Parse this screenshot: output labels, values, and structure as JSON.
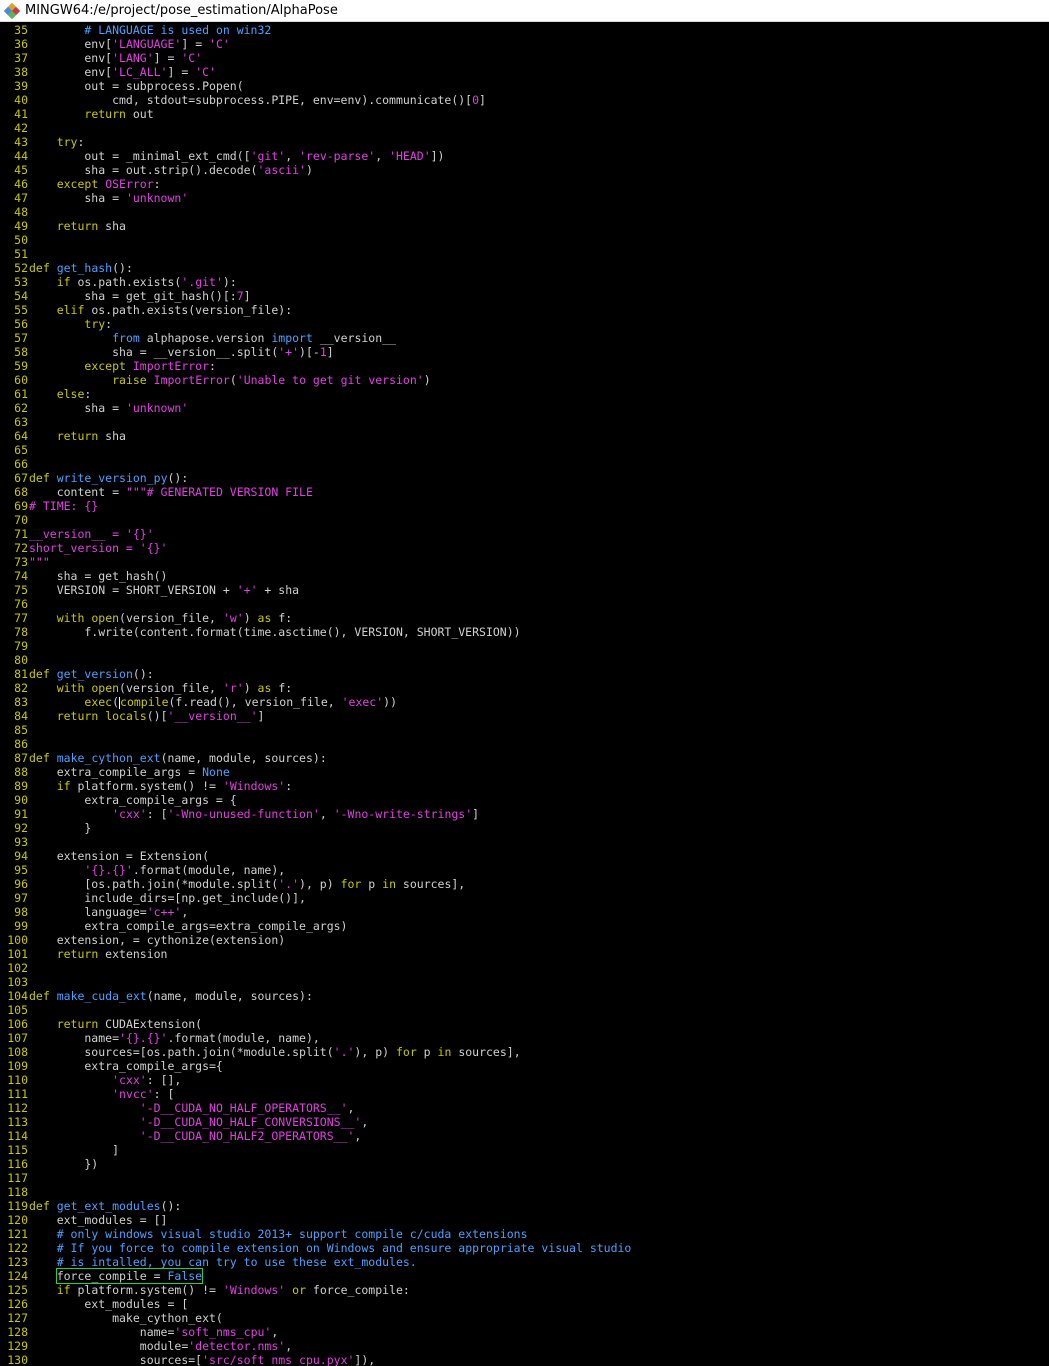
{
  "window": {
    "title": "MINGW64:/e/project/pose_estimation/AlphaPose"
  },
  "colors": {
    "line_number": "#c8c800",
    "keyword": "#c8c800",
    "string": "#e040e0",
    "comment": "#4aa0ff",
    "default": "#d0d0d0",
    "background": "#000000"
  },
  "lines": [
    {
      "n": "35",
      "t": [
        [
          "        ",
          ""
        ],
        [
          "# LANGUAGE is used on win32",
          "c"
        ]
      ]
    },
    {
      "n": "36",
      "t": [
        [
          "        env[",
          ""
        ],
        [
          "'LANGUAGE'",
          "s"
        ],
        [
          "] = ",
          ""
        ],
        [
          "'C'",
          "s"
        ]
      ]
    },
    {
      "n": "37",
      "t": [
        [
          "        env[",
          ""
        ],
        [
          "'LANG'",
          "s"
        ],
        [
          "] = ",
          ""
        ],
        [
          "'C'",
          "s"
        ]
      ]
    },
    {
      "n": "38",
      "t": [
        [
          "        env[",
          ""
        ],
        [
          "'LC_ALL'",
          "s"
        ],
        [
          "] = ",
          ""
        ],
        [
          "'C'",
          "s"
        ]
      ]
    },
    {
      "n": "39",
      "t": [
        [
          "        out = subprocess.Popen(",
          ""
        ]
      ]
    },
    {
      "n": "40",
      "t": [
        [
          "            cmd, stdout=subprocess.PIPE, env=env).communicate()[",
          ""
        ],
        [
          "0",
          "s"
        ],
        [
          "]",
          ""
        ]
      ]
    },
    {
      "n": "41",
      "t": [
        [
          "        ",
          ""
        ],
        [
          "return",
          "k"
        ],
        [
          " out",
          ""
        ]
      ]
    },
    {
      "n": "42",
      "t": []
    },
    {
      "n": "43",
      "t": [
        [
          "    ",
          ""
        ],
        [
          "try",
          "k"
        ],
        [
          ":",
          ""
        ]
      ]
    },
    {
      "n": "44",
      "t": [
        [
          "        out = _minimal_ext_cmd([",
          ""
        ],
        [
          "'git'",
          "s"
        ],
        [
          ", ",
          ""
        ],
        [
          "'rev-parse'",
          "s"
        ],
        [
          ", ",
          ""
        ],
        [
          "'HEAD'",
          "s"
        ],
        [
          "])",
          ""
        ]
      ]
    },
    {
      "n": "45",
      "t": [
        [
          "        sha = out.strip().decode(",
          ""
        ],
        [
          "'ascii'",
          "s"
        ],
        [
          ")",
          ""
        ]
      ]
    },
    {
      "n": "46",
      "t": [
        [
          "    ",
          ""
        ],
        [
          "except",
          "k"
        ],
        [
          " ",
          ""
        ],
        [
          "OSError",
          "s"
        ],
        [
          ":",
          ""
        ]
      ]
    },
    {
      "n": "47",
      "t": [
        [
          "        sha = ",
          ""
        ],
        [
          "'unknown'",
          "s"
        ]
      ]
    },
    {
      "n": "48",
      "t": []
    },
    {
      "n": "49",
      "t": [
        [
          "    ",
          ""
        ],
        [
          "return",
          "k"
        ],
        [
          " sha",
          ""
        ]
      ]
    },
    {
      "n": "50",
      "t": []
    },
    {
      "n": "51",
      "t": []
    },
    {
      "n": "52",
      "t": [
        [
          "def",
          "k"
        ],
        [
          " ",
          ""
        ],
        [
          "get_hash",
          "b"
        ],
        [
          "():",
          ""
        ]
      ]
    },
    {
      "n": "53",
      "t": [
        [
          "    ",
          ""
        ],
        [
          "if",
          "k"
        ],
        [
          " os.path.exists(",
          ""
        ],
        [
          "'.git'",
          "s"
        ],
        [
          "):",
          ""
        ]
      ]
    },
    {
      "n": "54",
      "t": [
        [
          "        sha = get_git_hash()[:",
          ""
        ],
        [
          "7",
          "s"
        ],
        [
          "]",
          ""
        ]
      ]
    },
    {
      "n": "55",
      "t": [
        [
          "    ",
          ""
        ],
        [
          "elif",
          "k"
        ],
        [
          " os.path.exists(version_file):",
          ""
        ]
      ]
    },
    {
      "n": "56",
      "t": [
        [
          "        ",
          ""
        ],
        [
          "try",
          "k"
        ],
        [
          ":",
          ""
        ]
      ]
    },
    {
      "n": "57",
      "t": [
        [
          "            ",
          ""
        ],
        [
          "from",
          "b"
        ],
        [
          " alphapose.version ",
          ""
        ],
        [
          "import",
          "b"
        ],
        [
          " __version__",
          ""
        ]
      ]
    },
    {
      "n": "58",
      "t": [
        [
          "            sha = __version__.split(",
          ""
        ],
        [
          "'+'",
          "s"
        ],
        [
          ")[-",
          ""
        ],
        [
          "1",
          "s"
        ],
        [
          "]",
          ""
        ]
      ]
    },
    {
      "n": "59",
      "t": [
        [
          "        ",
          ""
        ],
        [
          "except",
          "k"
        ],
        [
          " ",
          ""
        ],
        [
          "ImportError",
          "s"
        ],
        [
          ":",
          ""
        ]
      ]
    },
    {
      "n": "60",
      "t": [
        [
          "            ",
          ""
        ],
        [
          "raise",
          "k"
        ],
        [
          " ",
          ""
        ],
        [
          "ImportError",
          "s"
        ],
        [
          "(",
          ""
        ],
        [
          "'Unable to get git version'",
          "s"
        ],
        [
          ")",
          ""
        ]
      ]
    },
    {
      "n": "61",
      "t": [
        [
          "    ",
          ""
        ],
        [
          "else",
          "k"
        ],
        [
          ":",
          ""
        ]
      ]
    },
    {
      "n": "62",
      "t": [
        [
          "        sha = ",
          ""
        ],
        [
          "'unknown'",
          "s"
        ]
      ]
    },
    {
      "n": "63",
      "t": []
    },
    {
      "n": "64",
      "t": [
        [
          "    ",
          ""
        ],
        [
          "return",
          "k"
        ],
        [
          " sha",
          ""
        ]
      ]
    },
    {
      "n": "65",
      "t": []
    },
    {
      "n": "66",
      "t": []
    },
    {
      "n": "67",
      "t": [
        [
          "def",
          "k"
        ],
        [
          " ",
          ""
        ],
        [
          "write_version_py",
          "b"
        ],
        [
          "():",
          ""
        ]
      ]
    },
    {
      "n": "68",
      "t": [
        [
          "    content = ",
          ""
        ],
        [
          "\"\"\"# GENERATED VERSION FILE",
          "s"
        ]
      ]
    },
    {
      "n": "69",
      "t": [
        [
          "# TIME: {}",
          "s"
        ]
      ]
    },
    {
      "n": "70",
      "t": []
    },
    {
      "n": "71",
      "t": [
        [
          "__version__ = '{}'",
          "s"
        ]
      ]
    },
    {
      "n": "72",
      "t": [
        [
          "short_version = '{}'",
          "s"
        ]
      ]
    },
    {
      "n": "73",
      "t": [
        [
          "\"\"\"",
          "s"
        ]
      ]
    },
    {
      "n": "74",
      "t": [
        [
          "    sha = get_hash()",
          ""
        ]
      ]
    },
    {
      "n": "75",
      "t": [
        [
          "    VERSION = SHORT_VERSION + ",
          ""
        ],
        [
          "'+'",
          "s"
        ],
        [
          " + sha",
          ""
        ]
      ]
    },
    {
      "n": "76",
      "t": []
    },
    {
      "n": "77",
      "t": [
        [
          "    ",
          ""
        ],
        [
          "with",
          "k"
        ],
        [
          " ",
          ""
        ],
        [
          "open",
          "k"
        ],
        [
          "(version_file, ",
          ""
        ],
        [
          "'w'",
          "s"
        ],
        [
          ") ",
          ""
        ],
        [
          "as",
          "k"
        ],
        [
          " f:",
          ""
        ]
      ]
    },
    {
      "n": "78",
      "t": [
        [
          "        f.write(content.format(time.asctime(), VERSION, SHORT_VERSION))",
          ""
        ]
      ]
    },
    {
      "n": "79",
      "t": []
    },
    {
      "n": "80",
      "t": []
    },
    {
      "n": "81",
      "t": [
        [
          "def",
          "k"
        ],
        [
          " ",
          ""
        ],
        [
          "get_version",
          "b"
        ],
        [
          "():",
          ""
        ]
      ]
    },
    {
      "n": "82",
      "t": [
        [
          "    ",
          ""
        ],
        [
          "with",
          "k"
        ],
        [
          " ",
          ""
        ],
        [
          "open",
          "k"
        ],
        [
          "(version_file, ",
          ""
        ],
        [
          "'r'",
          "s"
        ],
        [
          ") ",
          ""
        ],
        [
          "as",
          "k"
        ],
        [
          " f:",
          ""
        ]
      ]
    },
    {
      "n": "83",
      "t": [
        [
          "        ",
          ""
        ],
        [
          "exec",
          "k"
        ],
        [
          "(",
          ""
        ],
        [
          "|",
          "cursor"
        ],
        [
          "compile",
          "k"
        ],
        [
          "(f.read(), version_file, ",
          ""
        ],
        [
          "'exec'",
          "s"
        ],
        [
          "))",
          ""
        ]
      ]
    },
    {
      "n": "84",
      "t": [
        [
          "    ",
          ""
        ],
        [
          "return",
          "k"
        ],
        [
          " ",
          ""
        ],
        [
          "locals",
          "k"
        ],
        [
          "()[",
          ""
        ],
        [
          "'__version__'",
          "s"
        ],
        [
          "]",
          ""
        ]
      ]
    },
    {
      "n": "85",
      "t": []
    },
    {
      "n": "86",
      "t": []
    },
    {
      "n": "87",
      "t": [
        [
          "def",
          "k"
        ],
        [
          " ",
          ""
        ],
        [
          "make_cython_ext",
          "b"
        ],
        [
          "(name, module, sources):",
          ""
        ]
      ]
    },
    {
      "n": "88",
      "t": [
        [
          "    extra_compile_args = ",
          ""
        ],
        [
          "None",
          "b"
        ]
      ]
    },
    {
      "n": "89",
      "t": [
        [
          "    ",
          ""
        ],
        [
          "if",
          "k"
        ],
        [
          " platform.system() != ",
          ""
        ],
        [
          "'Windows'",
          "s"
        ],
        [
          ":",
          ""
        ]
      ]
    },
    {
      "n": "90",
      "t": [
        [
          "        extra_compile_args = {",
          ""
        ]
      ]
    },
    {
      "n": "91",
      "t": [
        [
          "            ",
          ""
        ],
        [
          "'cxx'",
          "s"
        ],
        [
          ": [",
          ""
        ],
        [
          "'-Wno-unused-function'",
          "s"
        ],
        [
          ", ",
          ""
        ],
        [
          "'-Wno-write-strings'",
          "s"
        ],
        [
          "]",
          ""
        ]
      ]
    },
    {
      "n": "92",
      "t": [
        [
          "        }",
          ""
        ]
      ]
    },
    {
      "n": "93",
      "t": []
    },
    {
      "n": "94",
      "t": [
        [
          "    extension = Extension(",
          ""
        ]
      ]
    },
    {
      "n": "95",
      "t": [
        [
          "        ",
          ""
        ],
        [
          "'{}.{}'",
          "s"
        ],
        [
          ".format(module, name),",
          ""
        ]
      ]
    },
    {
      "n": "96",
      "t": [
        [
          "        [os.path.join(*module.split(",
          ""
        ],
        [
          "'.'",
          "s"
        ],
        [
          "), p) ",
          ""
        ],
        [
          "for",
          "k"
        ],
        [
          " p ",
          ""
        ],
        [
          "in",
          "k"
        ],
        [
          " sources],",
          ""
        ]
      ]
    },
    {
      "n": "97",
      "t": [
        [
          "        include_dirs=[np.get_include()],",
          ""
        ]
      ]
    },
    {
      "n": "98",
      "t": [
        [
          "        language=",
          ""
        ],
        [
          "'c++'",
          "s"
        ],
        [
          ",",
          ""
        ]
      ]
    },
    {
      "n": "99",
      "t": [
        [
          "        extra_compile_args=extra_compile_args)",
          ""
        ]
      ]
    },
    {
      "n": "100",
      "t": [
        [
          "    extension, = cythonize(extension)",
          ""
        ]
      ]
    },
    {
      "n": "101",
      "t": [
        [
          "    ",
          ""
        ],
        [
          "return",
          "k"
        ],
        [
          " extension",
          ""
        ]
      ]
    },
    {
      "n": "102",
      "t": []
    },
    {
      "n": "103",
      "t": []
    },
    {
      "n": "104",
      "t": [
        [
          "def",
          "k"
        ],
        [
          " ",
          ""
        ],
        [
          "make_cuda_ext",
          "b"
        ],
        [
          "(name, module, sources):",
          ""
        ]
      ]
    },
    {
      "n": "105",
      "t": []
    },
    {
      "n": "106",
      "t": [
        [
          "    ",
          ""
        ],
        [
          "return",
          "k"
        ],
        [
          " CUDAExtension(",
          ""
        ]
      ]
    },
    {
      "n": "107",
      "t": [
        [
          "        name=",
          ""
        ],
        [
          "'{}.{}'",
          "s"
        ],
        [
          ".format(module, name),",
          ""
        ]
      ]
    },
    {
      "n": "108",
      "t": [
        [
          "        sources=[os.path.join(*module.split(",
          ""
        ],
        [
          "'.'",
          "s"
        ],
        [
          "), p) ",
          ""
        ],
        [
          "for",
          "k"
        ],
        [
          " p ",
          ""
        ],
        [
          "in",
          "k"
        ],
        [
          " sources],",
          ""
        ]
      ]
    },
    {
      "n": "109",
      "t": [
        [
          "        extra_compile_args={",
          ""
        ]
      ]
    },
    {
      "n": "110",
      "t": [
        [
          "            ",
          ""
        ],
        [
          "'cxx'",
          "s"
        ],
        [
          ": [],",
          ""
        ]
      ]
    },
    {
      "n": "111",
      "t": [
        [
          "            ",
          ""
        ],
        [
          "'nvcc'",
          "s"
        ],
        [
          ": [",
          ""
        ]
      ]
    },
    {
      "n": "112",
      "t": [
        [
          "                ",
          ""
        ],
        [
          "'-D__CUDA_NO_HALF_OPERATORS__'",
          "s"
        ],
        [
          ",",
          ""
        ]
      ]
    },
    {
      "n": "113",
      "t": [
        [
          "                ",
          ""
        ],
        [
          "'-D__CUDA_NO_HALF_CONVERSIONS__'",
          "s"
        ],
        [
          ",",
          ""
        ]
      ]
    },
    {
      "n": "114",
      "t": [
        [
          "                ",
          ""
        ],
        [
          "'-D__CUDA_NO_HALF2_OPERATORS__'",
          "s"
        ],
        [
          ",",
          ""
        ]
      ]
    },
    {
      "n": "115",
      "t": [
        [
          "            ]",
          ""
        ]
      ]
    },
    {
      "n": "116",
      "t": [
        [
          "        })",
          ""
        ]
      ]
    },
    {
      "n": "117",
      "t": []
    },
    {
      "n": "118",
      "t": []
    },
    {
      "n": "119",
      "t": [
        [
          "def",
          "k"
        ],
        [
          " ",
          ""
        ],
        [
          "get_ext_modules",
          "b"
        ],
        [
          "():",
          ""
        ]
      ]
    },
    {
      "n": "120",
      "t": [
        [
          "    ext_modules = []",
          ""
        ]
      ]
    },
    {
      "n": "121",
      "t": [
        [
          "    ",
          ""
        ],
        [
          "# only windows visual studio 2013+ support compile c/cuda extensions",
          "c"
        ]
      ]
    },
    {
      "n": "122",
      "t": [
        [
          "    ",
          ""
        ],
        [
          "# If you force to compile extension on Windows and ensure appropriate visual studio",
          "c"
        ]
      ]
    },
    {
      "n": "123",
      "t": [
        [
          "    ",
          ""
        ],
        [
          "# is intalled, you can try to use these ext_modules.",
          "c"
        ]
      ]
    },
    {
      "n": "124",
      "hl": true,
      "t": [
        [
          "    ",
          ""
        ],
        [
          "force_compile = ",
          ""
        ],
        [
          "False",
          "b"
        ]
      ]
    },
    {
      "n": "125",
      "t": [
        [
          "    ",
          ""
        ],
        [
          "if",
          "k"
        ],
        [
          " platform.system() != ",
          ""
        ],
        [
          "'Windows'",
          "s"
        ],
        [
          " ",
          ""
        ],
        [
          "or",
          "k"
        ],
        [
          " force_compile:",
          ""
        ]
      ]
    },
    {
      "n": "126",
      "t": [
        [
          "        ext_modules = [",
          ""
        ]
      ]
    },
    {
      "n": "127",
      "t": [
        [
          "            make_cython_ext(",
          ""
        ]
      ]
    },
    {
      "n": "128",
      "t": [
        [
          "                name=",
          ""
        ],
        [
          "'soft_nms_cpu'",
          "s"
        ],
        [
          ",",
          ""
        ]
      ]
    },
    {
      "n": "129",
      "t": [
        [
          "                module=",
          ""
        ],
        [
          "'detector.nms'",
          "s"
        ],
        [
          ",",
          ""
        ]
      ]
    },
    {
      "n": "130",
      "t": [
        [
          "                sources=[",
          ""
        ],
        [
          "'src/soft_nms_cpu.pyx'",
          "s"
        ],
        [
          "]),",
          ""
        ]
      ]
    }
  ]
}
